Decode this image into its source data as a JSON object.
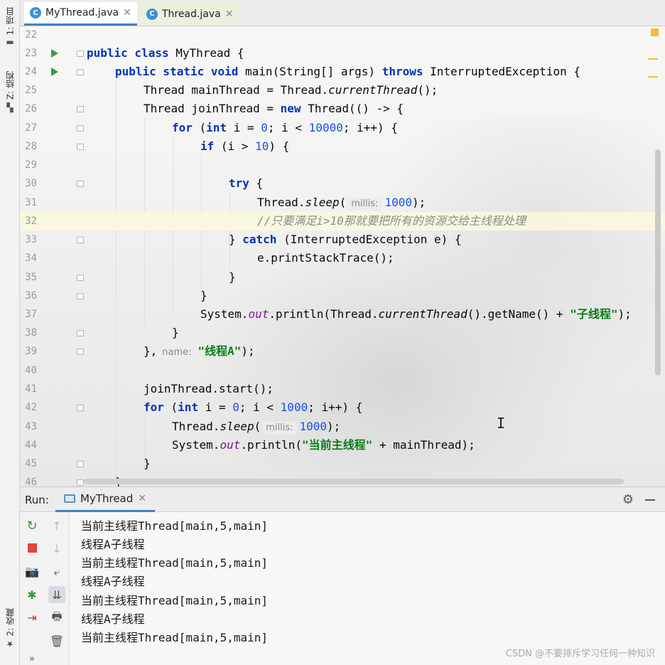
{
  "left_strip": {
    "project_label": "1: 项目",
    "structure_label": "Z: 结构",
    "favorites_label": "2: 收藏"
  },
  "tabs": [
    {
      "label": "MyThread.java",
      "icon": "C",
      "active": true
    },
    {
      "label": "Thread.java",
      "icon": "C",
      "active": false
    }
  ],
  "editor": {
    "line_numbers": [
      "22",
      "23",
      "24",
      "25",
      "26",
      "27",
      "28",
      "29",
      "30",
      "31",
      "32",
      "33",
      "34",
      "35",
      "36",
      "37",
      "38",
      "39",
      "40",
      "41",
      "42",
      "43",
      "44",
      "45",
      "46"
    ],
    "code": {
      "l23": {
        "kw1": "public class ",
        "t1": "MyThread {"
      },
      "l24": {
        "kw1": "public static void ",
        "t1": "main(String[] args) ",
        "kw2": "throws ",
        "t2": "InterruptedException {"
      },
      "l25": {
        "t1": "Thread mainThread = Thread.",
        "it1": "currentThread",
        "t2": "();"
      },
      "l26": {
        "t1": "Thread joinThread = ",
        "kw1": "new ",
        "t2": "Thread(() -> {"
      },
      "l27": {
        "kw1": "for ",
        "t1": "(",
        "kw2": "int ",
        "t2": "i = ",
        "n1": "0",
        "t3": "; i < ",
        "n2": "10000",
        "t4": "; i++) {"
      },
      "l28": {
        "kw1": "if ",
        "t1": "(i > ",
        "n1": "10",
        "t2": ") {"
      },
      "l30": {
        "kw1": "try ",
        "t1": "{"
      },
      "l31": {
        "t1": "Thread.",
        "it1": "sleep",
        "t2": "(",
        "hint": "millis:",
        "n1": "1000",
        "t3": ");"
      },
      "l32": {
        "cmt": "//只要满足i>10那就要把所有的资源交给主线程处理"
      },
      "l33": {
        "t1": "} ",
        "kw1": "catch ",
        "t2": "(InterruptedException e) {"
      },
      "l34": {
        "t1": "e.printStackTrace();"
      },
      "l35": {
        "t1": "}"
      },
      "l36": {
        "t1": "}"
      },
      "l37": {
        "t1": "System.",
        "fld": "out",
        "t2": ".println(Thread.",
        "it1": "currentThread",
        "t3": "().getName() + ",
        "s1": "\"子线程\"",
        "t4": ");"
      },
      "l38": {
        "t1": "}"
      },
      "l39": {
        "t1": "},",
        "hint": "name:",
        "s1": "\"线程A\"",
        "t2": ");"
      },
      "l41": {
        "t1": "joinThread.start();"
      },
      "l42": {
        "kw1": "for ",
        "t1": "(",
        "kw2": "int ",
        "t2": "i = ",
        "n1": "0",
        "t3": "; i < ",
        "n2": "1000",
        "t4": "; i++) {"
      },
      "l43": {
        "t1": "Thread.",
        "it1": "sleep",
        "t2": "(",
        "hint": "millis:",
        "n1": "1000",
        "t3": ");"
      },
      "l44": {
        "t1": "System.",
        "fld": "out",
        "t2": ".println(",
        "s1": "\"当前主线程\"",
        "t3": " + mainThread);"
      },
      "l45": {
        "t1": "}"
      },
      "l46": {
        "t1": "}"
      }
    }
  },
  "run_panel": {
    "label": "Run:",
    "tab_label": "MyThread",
    "output": [
      "当前主线程Thread[main,5,main]",
      "线程A子线程",
      "当前主线程Thread[main,5,main]",
      "线程A子线程",
      "当前主线程Thread[main,5,main]",
      "线程A子线程",
      "当前主线程Thread[main,5,main]"
    ],
    "more_glyph": "»"
  },
  "watermark": "CSDN @不要排斥学习任何一种知识",
  "colors": {
    "keyword": "#0033b3",
    "number": "#1750eb",
    "string": "#067d17",
    "comment": "#8c8c8c",
    "field": "#871094",
    "run_green": "#2ea043",
    "stop_red": "#e0443e",
    "accent_blue": "#4083c9"
  }
}
